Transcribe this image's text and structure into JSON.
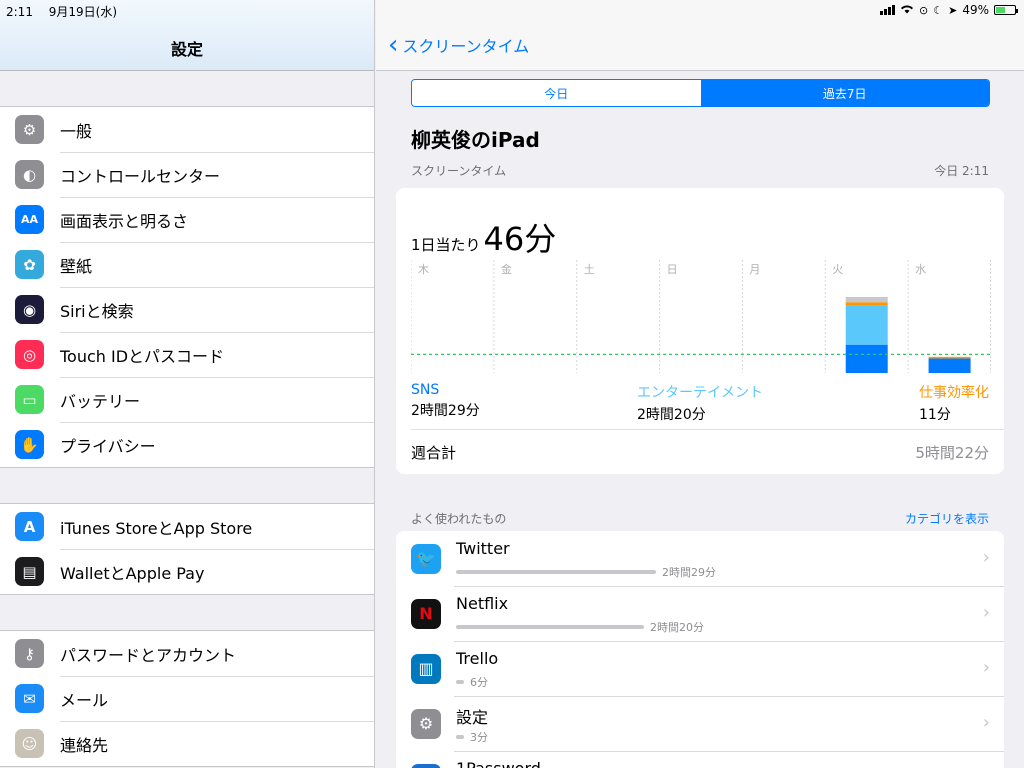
{
  "status": {
    "time": "2:11",
    "date": "9月19日(水)",
    "battery": "49%"
  },
  "sidebar": {
    "title": "設定",
    "groups": [
      [
        {
          "label": "一般",
          "icon": "gear-icon",
          "color": "#8e8e93"
        },
        {
          "label": "コントロールセンター",
          "icon": "toggles-icon",
          "color": "#8e8e93"
        },
        {
          "label": "画面表示と明るさ",
          "icon": "text-size-icon",
          "color": "#007aff"
        },
        {
          "label": "壁紙",
          "icon": "flower-icon",
          "color": "#34aadc"
        },
        {
          "label": "Siriと検索",
          "icon": "siri-icon",
          "color": "#1c1c3a"
        },
        {
          "label": "Touch IDとパスコード",
          "icon": "fingerprint-icon",
          "color": "#ff2d55"
        },
        {
          "label": "バッテリー",
          "icon": "battery-icon",
          "color": "#4cd964"
        },
        {
          "label": "プライバシー",
          "icon": "hand-icon",
          "color": "#007aff"
        }
      ],
      [
        {
          "label": "iTunes StoreとApp Store",
          "icon": "app-store-icon",
          "color": "#1a8cf7"
        },
        {
          "label": "WalletとApple Pay",
          "icon": "wallet-icon",
          "color": "#1c1c1e"
        }
      ],
      [
        {
          "label": "パスワードとアカウント",
          "icon": "key-icon",
          "color": "#8e8e93"
        },
        {
          "label": "メール",
          "icon": "mail-icon",
          "color": "#1a8cf7"
        },
        {
          "label": "連絡先",
          "icon": "contacts-icon",
          "color": "#c8c2b5"
        }
      ]
    ]
  },
  "detail": {
    "back_label": "スクリーンタイム",
    "segments": [
      "今日",
      "過去7日"
    ],
    "device_title": "柳英俊のiPad",
    "section_label": "スクリーンタイム",
    "section_time": "今日 2:11",
    "daily_avg_prefix": "1日当たり",
    "daily_avg_value": "46分",
    "categories": [
      {
        "name": "SNS",
        "value": "2時間29分",
        "color": "#007aff"
      },
      {
        "name": "エンターテイメント",
        "value": "2時間20分",
        "color": "#5ac8fa"
      },
      {
        "name": "仕事効率化",
        "value": "11分",
        "color": "#ff9500"
      }
    ],
    "week_total_label": "週合計",
    "week_total_value": "5時間22分",
    "most_used_label": "よく使われたもの",
    "show_categories_link": "カテゴリを表示",
    "apps": [
      {
        "name": "Twitter",
        "time": "2時間29分",
        "icon": "twitter-icon",
        "color": "#1da1f2",
        "share": 1.0
      },
      {
        "name": "Netflix",
        "time": "2時間20分",
        "icon": "netflix-icon",
        "color": "#111111",
        "share": 0.94
      },
      {
        "name": "Trello",
        "time": "6分",
        "icon": "trello-icon",
        "color": "#0079bf",
        "share": 0.04
      },
      {
        "name": "設定",
        "time": "3分",
        "icon": "settings-gear-icon",
        "color": "#8e8e93",
        "share": 0.02
      },
      {
        "name": "1Password",
        "time": "",
        "icon": "1password-icon",
        "color": "#1a6fd0",
        "share": 0
      }
    ]
  },
  "chart_data": {
    "type": "bar",
    "stacked": true,
    "categories": [
      "木",
      "金",
      "土",
      "日",
      "月",
      "火",
      "水"
    ],
    "series": [
      {
        "name": "SNS",
        "color": "#007aff",
        "values": [
          0,
          0,
          0,
          0,
          0,
          70,
          36
        ]
      },
      {
        "name": "エンターテイメント",
        "color": "#5ac8fa",
        "values": [
          0,
          0,
          0,
          0,
          0,
          98,
          0
        ]
      },
      {
        "name": "仕事効率化",
        "color": "#ff9500",
        "values": [
          0,
          0,
          0,
          0,
          0,
          7,
          4
        ]
      },
      {
        "name": "",
        "color": "#c7c7cc",
        "values": [
          0,
          0,
          0,
          0,
          0,
          13,
          0
        ]
      }
    ],
    "average_line": 46,
    "ylim": [
      0,
      230
    ],
    "grid": true
  }
}
